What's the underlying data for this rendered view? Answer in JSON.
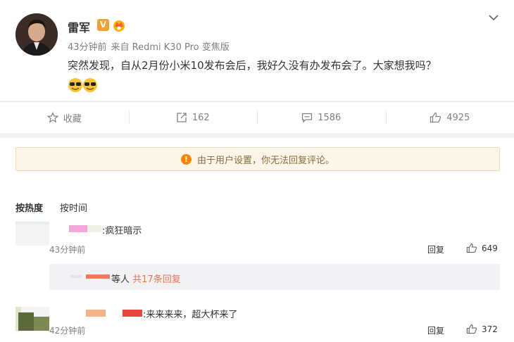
{
  "post": {
    "username": "雷军",
    "verified_badge": "V",
    "icons": {
      "verified": "verified-v-icon",
      "fan": "fan-badge-icon",
      "menu": "chevron-down-icon"
    },
    "time": "43分钟前",
    "source": "来自 Redmi K30 Pro 变焦版",
    "text": "突然发现，自从2月份小米10发布会后，我好久没有办发布会了。大家想我吗？",
    "emoji": "sunglasses-emoji"
  },
  "actions": {
    "favorite": "收藏",
    "repost_count": "162",
    "comment_count": "1586",
    "like_count": "4925"
  },
  "notice": {
    "text": "由于用户设置，你无法回复评论。",
    "icon": "!"
  },
  "sort": {
    "by_heat": "按热度",
    "by_time": "按时间"
  },
  "comments": [
    {
      "text": ":疯狂暗示",
      "time": "43分钟前",
      "reply": "回复",
      "likes": "649",
      "subreply": {
        "text": "等人",
        "link": "共17条回复"
      }
    },
    {
      "text": ":来来来来，超大杯来了",
      "time": "42分钟前",
      "reply": "回复",
      "likes": "372"
    }
  ],
  "colors": {
    "accent": "#ff8200",
    "link": "#eb7350",
    "muted": "#808080",
    "notice_bg": "#fcf5e9"
  }
}
